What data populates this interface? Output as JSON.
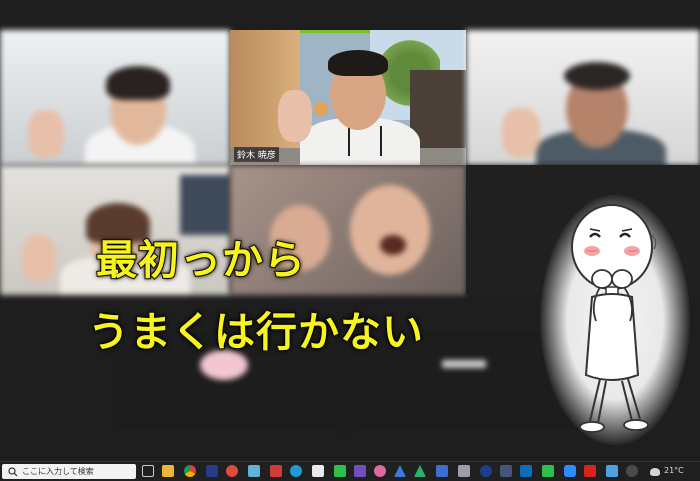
{
  "caption": {
    "line1": "最初っから",
    "line2": "うまくは行かない"
  },
  "participants": {
    "center_name": "鈴木 暁彦",
    "bottom_left_name": "",
    "bottom_mid_name": ""
  },
  "taskbar": {
    "search_placeholder": "ここに入力して検索",
    "weather": "21°C",
    "icons": [
      "task-view-icon",
      "file-explorer-icon",
      "chrome-icon",
      "jw-cad-icon",
      "app-icon",
      "edge-icon",
      "store-icon",
      "line-icon",
      "excel-icon",
      "zoom-icon",
      "word-icon",
      "acrobat-icon",
      "outlook-icon",
      "mail-icon",
      "settings-icon"
    ]
  },
  "colors": {
    "active_speaker": "#7bbf2a",
    "caption_fill": "#f7f31d",
    "taskbar_bg": "#202020"
  }
}
